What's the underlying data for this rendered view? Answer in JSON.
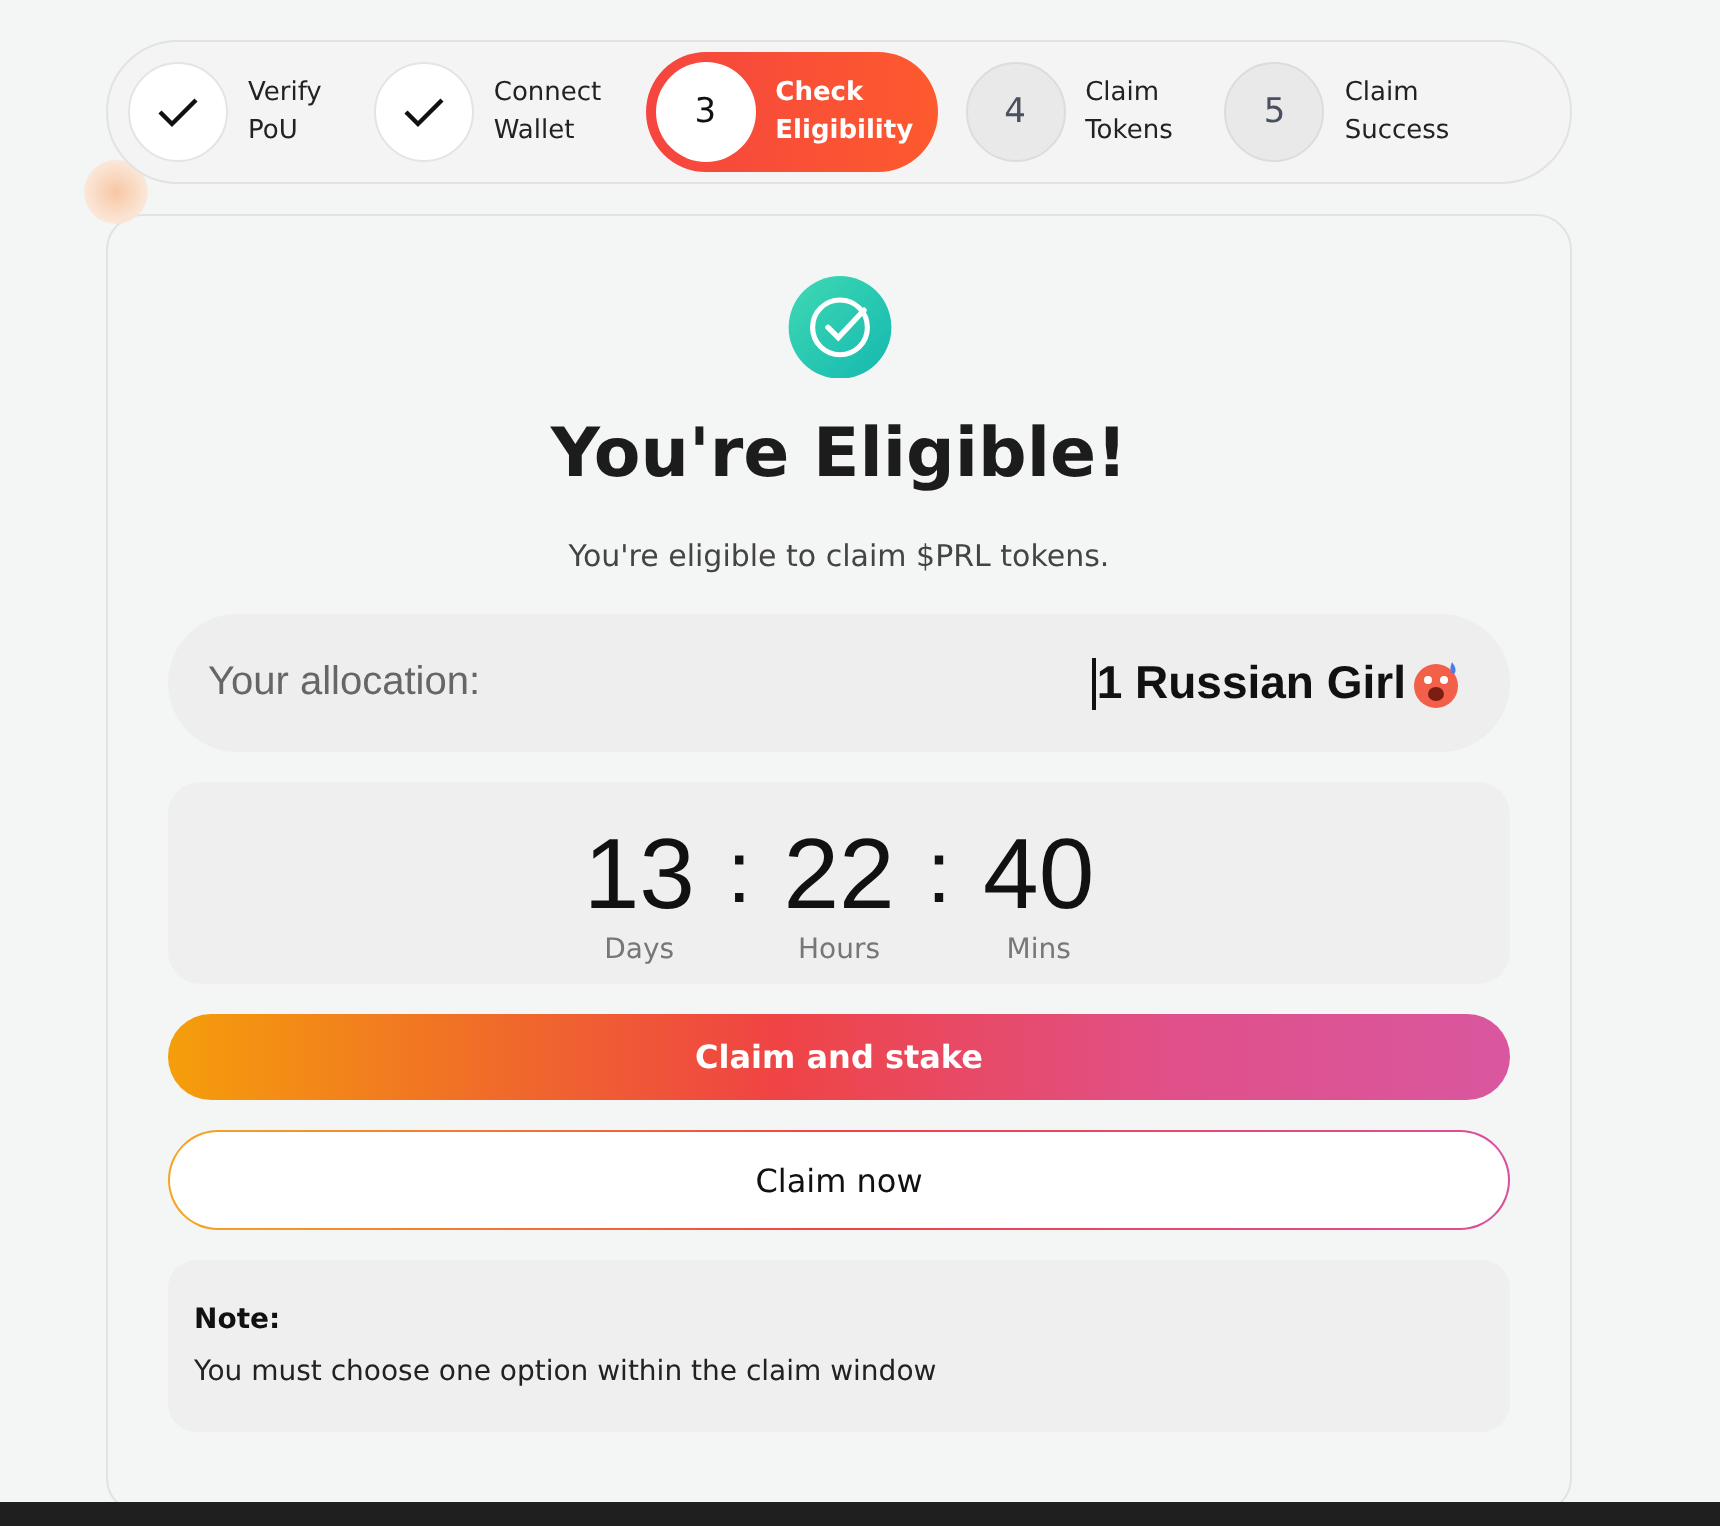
{
  "steps": [
    {
      "label_lines": [
        "Verify",
        "PoU"
      ],
      "kind": "done"
    },
    {
      "label_lines": [
        "Connect",
        "Wallet"
      ],
      "kind": "done"
    },
    {
      "number": "3",
      "label_lines": [
        "Check",
        "Eligibility"
      ],
      "kind": "active"
    },
    {
      "number": "4",
      "label_lines": [
        "Claim",
        "Tokens"
      ],
      "kind": "pending"
    },
    {
      "number": "5",
      "label_lines": [
        "Claim",
        "Success"
      ],
      "kind": "pending"
    }
  ],
  "result": {
    "title": "You're Eligible!",
    "subtitle": "You're eligible to claim $PRL tokens."
  },
  "allocation": {
    "label": "Your allocation:",
    "value": "1 Russian Girl"
  },
  "countdown": [
    {
      "value": "13",
      "unit": "Days"
    },
    {
      "value": "22",
      "unit": "Hours"
    },
    {
      "value": "40",
      "unit": "Mins"
    }
  ],
  "countdown_separator": ":",
  "buttons": [
    {
      "label": "Claim and stake",
      "kind": "primary"
    },
    {
      "label": "Claim now",
      "kind": "outline"
    }
  ],
  "note": {
    "title": "Note:",
    "text": "You must choose one option within the claim window"
  }
}
